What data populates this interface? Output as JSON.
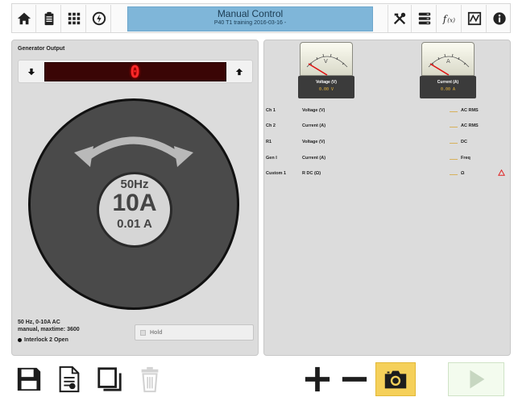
{
  "header": {
    "title": "Manual Control",
    "subtitle": "P40 T1 training 2016-03-16 -",
    "left_icons": [
      "home-icon",
      "clipboard-icon",
      "keypad-icon",
      "power-icon"
    ],
    "right_icons": [
      "tools-icon",
      "server-icon",
      "function-icon",
      "signal-icon",
      "info-icon"
    ]
  },
  "generator": {
    "section_title": "Generator Output",
    "display_value": "0",
    "dial_frequency": "50Hz",
    "dial_amplitude": "10A",
    "dial_resolution": "0.01 A",
    "info_line1": "50 Hz, 0-10A AC",
    "info_line2": "manual, maxtime: 3600",
    "interlock": "Interlock 2 Open",
    "hold_label": "Hold"
  },
  "meters": {
    "voltage": {
      "label": "Voltage (V)",
      "value": "0.00 V",
      "unit_glyph": "V"
    },
    "current": {
      "label": "Current (A)",
      "value": "0.00 A",
      "unit_glyph": "A"
    }
  },
  "channels": [
    {
      "name": "Ch 1",
      "measurement": "Voltage (V)",
      "mode": "AC RMS",
      "warning": false
    },
    {
      "name": "Ch 2",
      "measurement": "Current (A)",
      "mode": "AC RMS",
      "warning": false
    },
    {
      "name": "R1",
      "measurement": "Voltage (V)",
      "mode": "DC",
      "warning": false
    },
    {
      "name": "Gen I",
      "measurement": "Current (A)",
      "mode": "Freq",
      "warning": false
    },
    {
      "name": "Custom 1",
      "measurement": "R DC (Ω)",
      "mode": "Ω",
      "warning": true
    }
  ],
  "bottom": {
    "icons": [
      "save-icon",
      "new-file-icon",
      "copy-icon",
      "delete-icon",
      "plus-icon",
      "minus-icon",
      "camera-icon",
      "play-icon"
    ]
  },
  "colors": {
    "title_bar": "#7fb6d9",
    "segment_display_bg": "#3a0505",
    "segment_digit": "#ff2a2a",
    "camera_button": "#f5d05a",
    "warning": "#e02020"
  }
}
